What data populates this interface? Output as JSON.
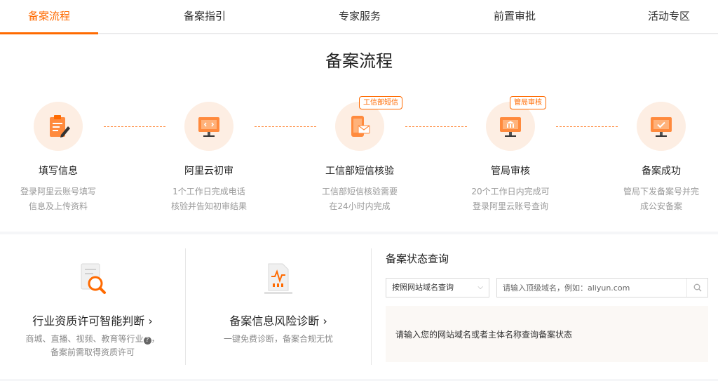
{
  "tabs": [
    {
      "label": "备案流程",
      "active": true
    },
    {
      "label": "备案指引",
      "active": false
    },
    {
      "label": "专家服务",
      "active": false
    },
    {
      "label": "前置审批",
      "active": false
    },
    {
      "label": "活动专区",
      "active": false
    }
  ],
  "process": {
    "title": "备案流程",
    "steps": [
      {
        "icon": "clipboard-edit-icon",
        "tag": "",
        "name": "填写信息",
        "desc1": "登录阿里云账号填写",
        "desc2": "信息及上传资料"
      },
      {
        "icon": "monitor-icon",
        "tag": "",
        "name": "阿里云初审",
        "desc1": "1个工作日完成电话",
        "desc2": "核验并告知初审结果"
      },
      {
        "icon": "phone-message-icon",
        "tag": "工信部短信",
        "name": "工信部短信核验",
        "desc1": "工信部短信核验需要",
        "desc2": "在24小时内完成"
      },
      {
        "icon": "government-monitor-icon",
        "tag": "管局审核",
        "name": "管局审核",
        "desc1": "20个工作日内完成可",
        "desc2": "登录阿里云账号查询"
      },
      {
        "icon": "check-monitor-icon",
        "tag": "",
        "name": "备案成功",
        "desc1": "管局下发备案号并完",
        "desc2": "成公安备案"
      }
    ]
  },
  "cards": [
    {
      "icon": "document-search-icon",
      "title": "行业资质许可智能判断",
      "arrow": "›",
      "desc1": "商城、直播、视频、教育等行业",
      "help": "?",
      "desc1_tail": "，",
      "desc2": "备案前需取得资质许可"
    },
    {
      "icon": "risk-report-icon",
      "title": "备案信息风险诊断",
      "arrow": "›",
      "desc1": "一键免费诊断，备案合规无忧",
      "help": "",
      "desc1_tail": "",
      "desc2": ""
    }
  ],
  "query": {
    "title": "备案状态查询",
    "select_value": "按照网站域名查询",
    "input_placeholder": "请输入顶级域名，例如：aliyun.com",
    "input_value": "",
    "result_text": "请输入您的网站域名或者主体名称查询备案状态"
  },
  "colors": {
    "accent": "#ff6a00",
    "circle_bg": "#fdeee3",
    "result_bg": "#fbf8f5"
  }
}
